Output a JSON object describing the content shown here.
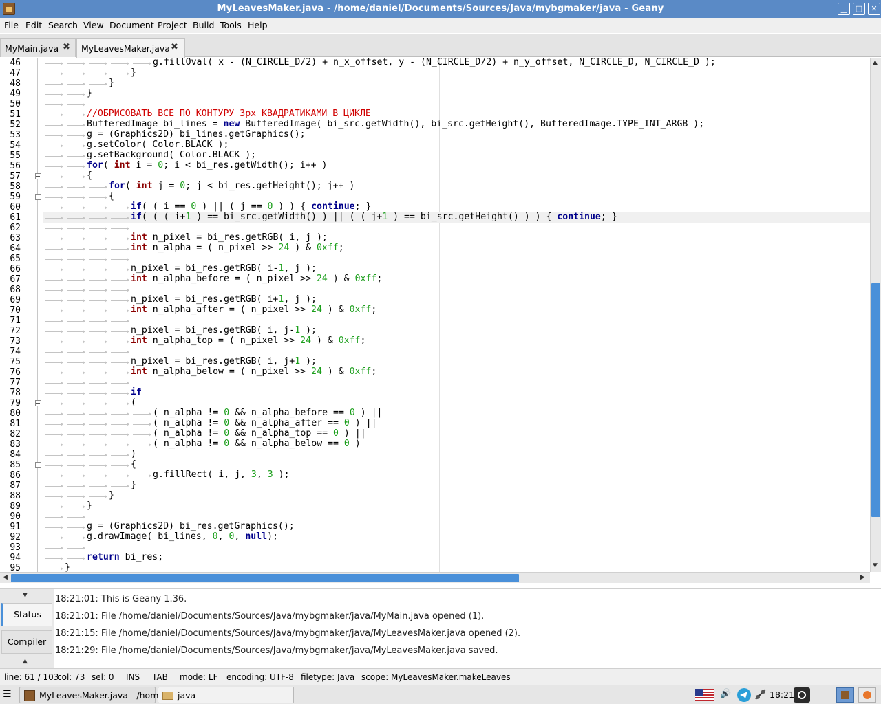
{
  "window": {
    "title": "MyLeavesMaker.java - /home/daniel/Documents/Sources/Java/mybgmaker/java - Geany",
    "controls": [
      "▁",
      "□",
      "✕"
    ]
  },
  "menu": [
    "File",
    "Edit",
    "Search",
    "View",
    "Document",
    "Project",
    "Build",
    "Tools",
    "Help"
  ],
  "tabs": [
    {
      "label": "MyMain.java",
      "close": "✖",
      "active": false
    },
    {
      "label": "MyLeavesMaker.java",
      "close": "✖",
      "active": true
    }
  ],
  "editor": {
    "current_line": 61,
    "lines": [
      {
        "n": "46",
        "indent": 5,
        "fold": false,
        "tokens": [
          [
            "t",
            "g.fillOval( x - (N_CIRCLE_D/2) + n_x_offset, y - (N_CIRCLE_D/2) + n_y_offset, N_CIRCLE_D, N_CIRCLE_D );"
          ]
        ]
      },
      {
        "n": "47",
        "indent": 4,
        "fold": false,
        "tokens": [
          [
            "t",
            "}"
          ]
        ]
      },
      {
        "n": "48",
        "indent": 3,
        "fold": false,
        "tokens": [
          [
            "t",
            "}"
          ]
        ]
      },
      {
        "n": "49",
        "indent": 2,
        "fold": false,
        "tokens": [
          [
            "t",
            "}"
          ]
        ]
      },
      {
        "n": "50",
        "indent": 2,
        "fold": false,
        "tokens": []
      },
      {
        "n": "51",
        "indent": 2,
        "fold": false,
        "tokens": [
          [
            "cm",
            "//ОБРИСОВАТЬ ВСЕ ПО КОНТУРУ 3px КВАДРАТИКАМИ В ЦИКЛЕ"
          ]
        ]
      },
      {
        "n": "52",
        "indent": 2,
        "fold": false,
        "tokens": [
          [
            "t",
            "BufferedImage bi_lines = "
          ],
          [
            "kw",
            "new"
          ],
          [
            "t",
            " BufferedImage( bi_src.getWidth(), bi_src.getHeight(), BufferedImage.TYPE_INT_ARGB );"
          ]
        ]
      },
      {
        "n": "53",
        "indent": 2,
        "fold": false,
        "tokens": [
          [
            "t",
            "g = (Graphics2D) bi_lines.getGraphics();"
          ]
        ]
      },
      {
        "n": "54",
        "indent": 2,
        "fold": false,
        "tokens": [
          [
            "t",
            "g.setColor( Color.BLACK );"
          ]
        ]
      },
      {
        "n": "55",
        "indent": 2,
        "fold": false,
        "tokens": [
          [
            "t",
            "g.setBackground( Color.BLACK );"
          ]
        ]
      },
      {
        "n": "56",
        "indent": 2,
        "fold": false,
        "tokens": [
          [
            "kw",
            "for"
          ],
          [
            "t",
            "( "
          ],
          [
            "ty",
            "int"
          ],
          [
            "t",
            " i = "
          ],
          [
            "num",
            "0"
          ],
          [
            "t",
            "; i < bi_res.getWidth(); i++ )"
          ]
        ]
      },
      {
        "n": "57",
        "indent": 2,
        "fold": true,
        "tokens": [
          [
            "t",
            "{"
          ]
        ]
      },
      {
        "n": "58",
        "indent": 3,
        "fold": false,
        "tokens": [
          [
            "kw",
            "for"
          ],
          [
            "t",
            "( "
          ],
          [
            "ty",
            "int"
          ],
          [
            "t",
            " j = "
          ],
          [
            "num",
            "0"
          ],
          [
            "t",
            "; j < bi_res.getHeight(); j++ )"
          ]
        ]
      },
      {
        "n": "59",
        "indent": 3,
        "fold": true,
        "tokens": [
          [
            "t",
            "{"
          ]
        ]
      },
      {
        "n": "60",
        "indent": 4,
        "fold": false,
        "tokens": [
          [
            "kw",
            "if"
          ],
          [
            "t",
            "( ( i == "
          ],
          [
            "num",
            "0"
          ],
          [
            "t",
            " ) || ( j == "
          ],
          [
            "num",
            "0"
          ],
          [
            "t",
            " ) ) { "
          ],
          [
            "kw",
            "continue"
          ],
          [
            "t",
            "; }"
          ]
        ]
      },
      {
        "n": "61",
        "indent": 4,
        "fold": false,
        "tokens": [
          [
            "kw",
            "if"
          ],
          [
            "t",
            "( ( ( i+"
          ],
          [
            "num",
            "1"
          ],
          [
            "t",
            " ) == bi_src.getWidth() ) || ( ( j+"
          ],
          [
            "num",
            "1"
          ],
          [
            "t",
            " ) == bi_src.getHeight() ) ) { "
          ],
          [
            "kw",
            "continue"
          ],
          [
            "t",
            "; }"
          ]
        ]
      },
      {
        "n": "62",
        "indent": 4,
        "fold": false,
        "tokens": []
      },
      {
        "n": "63",
        "indent": 4,
        "fold": false,
        "tokens": [
          [
            "ty",
            "int"
          ],
          [
            "t",
            " n_pixel = bi_res.getRGB( i, j );"
          ]
        ]
      },
      {
        "n": "64",
        "indent": 4,
        "fold": false,
        "tokens": [
          [
            "ty",
            "int"
          ],
          [
            "t",
            " n_alpha = ( n_pixel >> "
          ],
          [
            "num",
            "24"
          ],
          [
            "t",
            " ) & "
          ],
          [
            "num",
            "0xff"
          ],
          [
            "t",
            ";"
          ]
        ]
      },
      {
        "n": "65",
        "indent": 4,
        "fold": false,
        "tokens": []
      },
      {
        "n": "66",
        "indent": 4,
        "fold": false,
        "tokens": [
          [
            "t",
            "n_pixel = bi_res.getRGB( i-"
          ],
          [
            "num",
            "1"
          ],
          [
            "t",
            ", j );"
          ]
        ]
      },
      {
        "n": "67",
        "indent": 4,
        "fold": false,
        "tokens": [
          [
            "ty",
            "int"
          ],
          [
            "t",
            " n_alpha_before = ( n_pixel >> "
          ],
          [
            "num",
            "24"
          ],
          [
            "t",
            " ) & "
          ],
          [
            "num",
            "0xff"
          ],
          [
            "t",
            ";"
          ]
        ]
      },
      {
        "n": "68",
        "indent": 4,
        "fold": false,
        "tokens": []
      },
      {
        "n": "69",
        "indent": 4,
        "fold": false,
        "tokens": [
          [
            "t",
            "n_pixel = bi_res.getRGB( i+"
          ],
          [
            "num",
            "1"
          ],
          [
            "t",
            ", j );"
          ]
        ]
      },
      {
        "n": "70",
        "indent": 4,
        "fold": false,
        "tokens": [
          [
            "ty",
            "int"
          ],
          [
            "t",
            " n_alpha_after = ( n_pixel >> "
          ],
          [
            "num",
            "24"
          ],
          [
            "t",
            " ) & "
          ],
          [
            "num",
            "0xff"
          ],
          [
            "t",
            ";"
          ]
        ]
      },
      {
        "n": "71",
        "indent": 4,
        "fold": false,
        "tokens": []
      },
      {
        "n": "72",
        "indent": 4,
        "fold": false,
        "tokens": [
          [
            "t",
            "n_pixel = bi_res.getRGB( i, j-"
          ],
          [
            "num",
            "1"
          ],
          [
            "t",
            " );"
          ]
        ]
      },
      {
        "n": "73",
        "indent": 4,
        "fold": false,
        "tokens": [
          [
            "ty",
            "int"
          ],
          [
            "t",
            " n_alpha_top = ( n_pixel >> "
          ],
          [
            "num",
            "24"
          ],
          [
            "t",
            " ) & "
          ],
          [
            "num",
            "0xff"
          ],
          [
            "t",
            ";"
          ]
        ]
      },
      {
        "n": "74",
        "indent": 4,
        "fold": false,
        "tokens": []
      },
      {
        "n": "75",
        "indent": 4,
        "fold": false,
        "tokens": [
          [
            "t",
            "n_pixel = bi_res.getRGB( i, j+"
          ],
          [
            "num",
            "1"
          ],
          [
            "t",
            " );"
          ]
        ]
      },
      {
        "n": "76",
        "indent": 4,
        "fold": false,
        "tokens": [
          [
            "ty",
            "int"
          ],
          [
            "t",
            " n_alpha_below = ( n_pixel >> "
          ],
          [
            "num",
            "24"
          ],
          [
            "t",
            " ) & "
          ],
          [
            "num",
            "0xff"
          ],
          [
            "t",
            ";"
          ]
        ]
      },
      {
        "n": "77",
        "indent": 4,
        "fold": false,
        "tokens": []
      },
      {
        "n": "78",
        "indent": 4,
        "fold": false,
        "tokens": [
          [
            "kw",
            "if"
          ]
        ]
      },
      {
        "n": "79",
        "indent": 4,
        "fold": true,
        "tokens": [
          [
            "t",
            "("
          ]
        ]
      },
      {
        "n": "80",
        "indent": 5,
        "fold": false,
        "tokens": [
          [
            "t",
            "( n_alpha != "
          ],
          [
            "num",
            "0"
          ],
          [
            "t",
            " && n_alpha_before == "
          ],
          [
            "num",
            "0"
          ],
          [
            "t",
            " ) ||"
          ]
        ]
      },
      {
        "n": "81",
        "indent": 5,
        "fold": false,
        "tokens": [
          [
            "t",
            "( n_alpha != "
          ],
          [
            "num",
            "0"
          ],
          [
            "t",
            " && n_alpha_after == "
          ],
          [
            "num",
            "0"
          ],
          [
            "t",
            " ) ||"
          ]
        ]
      },
      {
        "n": "82",
        "indent": 5,
        "fold": false,
        "tokens": [
          [
            "t",
            "( n_alpha != "
          ],
          [
            "num",
            "0"
          ],
          [
            "t",
            " && n_alpha_top == "
          ],
          [
            "num",
            "0"
          ],
          [
            "t",
            " ) ||"
          ]
        ]
      },
      {
        "n": "83",
        "indent": 5,
        "fold": false,
        "tokens": [
          [
            "t",
            "( n_alpha != "
          ],
          [
            "num",
            "0"
          ],
          [
            "t",
            " && n_alpha_below == "
          ],
          [
            "num",
            "0"
          ],
          [
            "t",
            " )"
          ]
        ]
      },
      {
        "n": "84",
        "indent": 4,
        "fold": false,
        "tokens": [
          [
            "t",
            ")"
          ]
        ]
      },
      {
        "n": "85",
        "indent": 4,
        "fold": true,
        "tokens": [
          [
            "t",
            "{"
          ]
        ]
      },
      {
        "n": "86",
        "indent": 5,
        "fold": false,
        "tokens": [
          [
            "t",
            "g.fillRect( i, j, "
          ],
          [
            "num",
            "3"
          ],
          [
            "t",
            ", "
          ],
          [
            "num",
            "3"
          ],
          [
            "t",
            " );"
          ]
        ]
      },
      {
        "n": "87",
        "indent": 4,
        "fold": false,
        "tokens": [
          [
            "t",
            "}"
          ]
        ]
      },
      {
        "n": "88",
        "indent": 3,
        "fold": false,
        "tokens": [
          [
            "t",
            "}"
          ]
        ]
      },
      {
        "n": "89",
        "indent": 2,
        "fold": false,
        "tokens": [
          [
            "t",
            "}"
          ]
        ]
      },
      {
        "n": "90",
        "indent": 2,
        "fold": false,
        "tokens": []
      },
      {
        "n": "91",
        "indent": 2,
        "fold": false,
        "tokens": [
          [
            "t",
            "g = (Graphics2D) bi_res.getGraphics();"
          ]
        ]
      },
      {
        "n": "92",
        "indent": 2,
        "fold": false,
        "tokens": [
          [
            "t",
            "g.drawImage( bi_lines, "
          ],
          [
            "num",
            "0"
          ],
          [
            "t",
            ", "
          ],
          [
            "num",
            "0"
          ],
          [
            "t",
            ", "
          ],
          [
            "kw",
            "null"
          ],
          [
            "t",
            ");"
          ]
        ]
      },
      {
        "n": "93",
        "indent": 2,
        "fold": false,
        "tokens": []
      },
      {
        "n": "94",
        "indent": 2,
        "fold": false,
        "tokens": [
          [
            "kw",
            "return"
          ],
          [
            "t",
            " bi_res;"
          ]
        ]
      },
      {
        "n": "95",
        "indent": 1,
        "fold": false,
        "tokens": [
          [
            "t",
            "}"
          ]
        ]
      }
    ]
  },
  "messages": {
    "tabs": [
      "Status",
      "Compiler"
    ],
    "active_tab": "Status",
    "lines": [
      "18:21:01: This is Geany 1.36.",
      "18:21:01: File /home/daniel/Documents/Sources/Java/mybgmaker/java/MyMain.java opened (1).",
      "18:21:15: File /home/daniel/Documents/Sources/Java/mybgmaker/java/MyLeavesMaker.java opened (2).",
      "18:21:29: File /home/daniel/Documents/Sources/Java/mybgmaker/java/MyLeavesMaker.java saved."
    ]
  },
  "statusbar": {
    "line": "line: 61 / 103",
    "col": "col: 73",
    "sel": "sel: 0",
    "ins": "INS",
    "tab": "TAB",
    "mode": "mode: LF",
    "encoding": "encoding: UTF-8",
    "filetype": "filetype: Java",
    "scope": "scope: MyLeavesMaker.makeLeaves"
  },
  "taskbar": {
    "items": [
      "MyLeavesMaker.java - /hom...",
      "java"
    ],
    "clock": "18:21"
  },
  "colors": {
    "titlebar": "#5a8ac6",
    "keyword": "#00008b",
    "type": "#8b0000",
    "number": "#1a9e1a",
    "comment": "#d00000",
    "scroll_thumb": "#4a90d9"
  }
}
